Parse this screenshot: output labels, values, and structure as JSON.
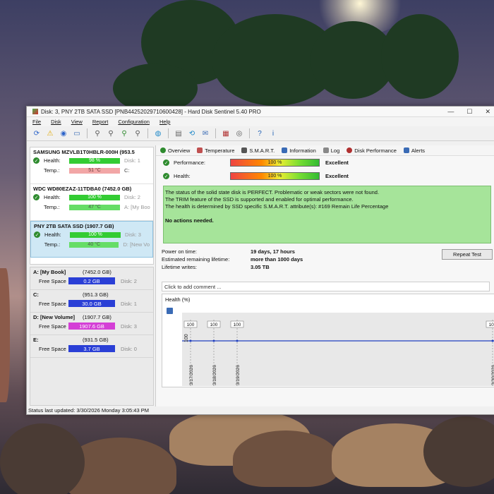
{
  "window": {
    "title": "Disk: 3, PNY 2TB SATA SSD [PNB44252029710600428]  -  Hard Disk Sentinel 5.40 PRO",
    "controls": [
      "—",
      "☐",
      "✕"
    ]
  },
  "menu": [
    "File",
    "Disk",
    "View",
    "Report",
    "Configuration",
    "Help"
  ],
  "disks": [
    {
      "name": "SAMSUNG MZVLB1T0HBLR-000H (953.5",
      "health_label": "Health:",
      "health": "98 %",
      "health_fill": 0.98,
      "disk_ref": "Disk: 1",
      "temp_label": "Temp.:",
      "temp": "51 °C",
      "drive_ref": "C:"
    },
    {
      "name": "WDC WD80EZAZ-11TDBA0 (7452.0 GB)",
      "health_label": "Health:",
      "health": "100 %",
      "health_fill": 1.0,
      "disk_ref": "Disk: 2",
      "temp_label": "Temp.:",
      "temp": "47 °C",
      "drive_ref": "A: [My Boo"
    },
    {
      "name": "PNY 2TB SATA SSD (1907.7 GB)",
      "health_label": "Health:",
      "health": "100 %",
      "health_fill": 1.0,
      "disk_ref": "Disk: 3",
      "temp_label": "Temp.:",
      "temp": "40 °C",
      "drive_ref": "D: [New Vo"
    }
  ],
  "partitions": [
    {
      "name": "A: [My Book]",
      "size": "(7452.0 GB)",
      "free_label": "Free Space",
      "free": "0.2 GB",
      "disk_ref": "Disk: 2",
      "color": "#2a3fd6"
    },
    {
      "name": "C:",
      "size": "(951.3 GB)",
      "free_label": "Free Space",
      "free": "30.0 GB",
      "disk_ref": "Disk: 1",
      "color": "#2a3fd6"
    },
    {
      "name": "D: [New Volume]",
      "size": "(1907.7 GB)",
      "free_label": "Free Space",
      "free": "1907.6 GB",
      "disk_ref": "Disk: 3",
      "color": "#d43fd6"
    },
    {
      "name": "E:",
      "size": "(931.5 GB)",
      "free_label": "Free Space",
      "free": "3.7 GB",
      "disk_ref": "Disk: 0",
      "color": "#2a3fd6"
    }
  ],
  "tabs": [
    "Overview",
    "Temperature",
    "S.M.A.R.T.",
    "Information",
    "Log",
    "Disk Performance",
    "Alerts"
  ],
  "performance": {
    "label": "Performance:",
    "value": "100 %",
    "rating": "Excellent"
  },
  "health": {
    "label": "Health:",
    "value": "100 %",
    "rating": "Excellent"
  },
  "status_text": {
    "line1": "The status of the solid state disk is PERFECT. Problematic or weak sectors were not found.",
    "line2": "The TRIM feature of the SSD is supported and enabled for optimal performance.",
    "line3": "The health is determined by SSD specific S.M.A.R.T. attribute(s):  #169 Remain Life Percentage",
    "actions": "No actions needed."
  },
  "info": {
    "power_on_label": "Power on time:",
    "power_on": "19 days, 17 hours",
    "remaining_label": "Estimated remaining lifetime:",
    "remaining": "more than 1000 days",
    "writes_label": "Lifetime writes:",
    "writes": "3.05 TB",
    "repeat_test": "Repeat Test"
  },
  "comment_placeholder": "Click to add comment ...",
  "graph": {
    "title": "Health (%)",
    "y_tick": "100",
    "points": [
      {
        "date": "3/17/2026",
        "value": "100"
      },
      {
        "date": "3/18/2026",
        "value": "100"
      },
      {
        "date": "3/19/2026",
        "value": "100"
      },
      {
        "date": "3/30/2026",
        "value": "100"
      }
    ]
  },
  "status_bar": "Status last updated: 3/30/2026 Monday 3:05:43 PM"
}
